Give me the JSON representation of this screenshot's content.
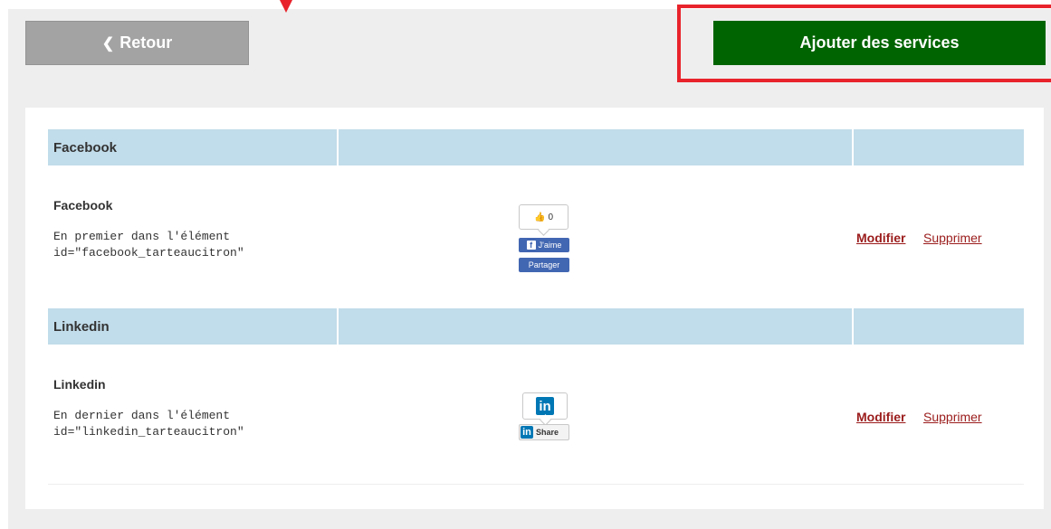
{
  "toolbar": {
    "back_label": "Retour",
    "add_label": "Ajouter des services"
  },
  "services": [
    {
      "header": "Facebook",
      "name": "Facebook",
      "position_text": "En premier dans l'élément",
      "id_text": "id=\"facebook_tarteaucitron\"",
      "widget": {
        "count": "0",
        "like_label": "J'aime",
        "share_label": "Partager"
      },
      "edit_label": "Modifier",
      "delete_label": "Supprimer"
    },
    {
      "header": "Linkedin",
      "name": "Linkedin",
      "position_text": "En dernier dans l'élément",
      "id_text": "id=\"linkedin_tarteaucitron\"",
      "widget": {
        "logo_text": "in",
        "share_label": "Share"
      },
      "edit_label": "Modifier",
      "delete_label": "Supprimer"
    }
  ],
  "colors": {
    "add_button": "#006400",
    "back_button": "#a3a3a3",
    "header_row": "#c1dcea",
    "highlight": "#e8232b",
    "link": "#9b1c1c"
  }
}
